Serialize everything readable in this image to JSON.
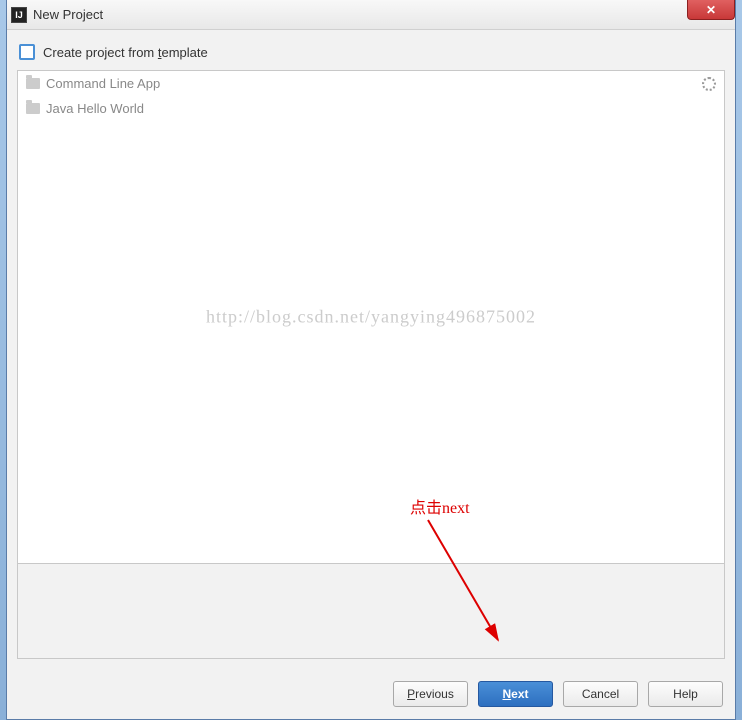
{
  "window": {
    "title": "New Project"
  },
  "checkbox": {
    "label_pre": "Create project from ",
    "mnemonic": "t",
    "label_post": "emplate",
    "checked": false
  },
  "templates": [
    {
      "label": "Command Line App"
    },
    {
      "label": "Java Hello World"
    }
  ],
  "watermark": "http://blog.csdn.net/yangying496875002",
  "annotation": "点击next",
  "buttons": {
    "previous": "Previous",
    "next": "Next",
    "cancel": "Cancel",
    "help": "Help"
  }
}
